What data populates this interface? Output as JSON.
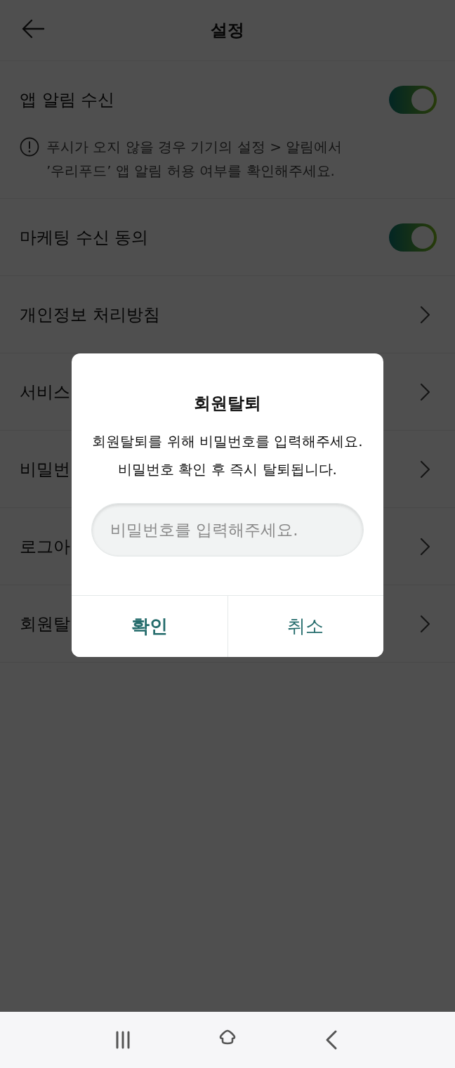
{
  "header": {
    "title": "설정"
  },
  "settings": [
    {
      "kind": "toggle",
      "label": "앱 알림 수신",
      "on": true,
      "note_lines": [
        "푸시가 오지 않을 경우 기기의 설정 > 알림에서",
        "’우리푸드’ 앱 알림 허용 여부를 확인해주세요."
      ]
    },
    {
      "kind": "toggle",
      "label": "마케팅 수신 동의",
      "on": true
    },
    {
      "kind": "link",
      "label": "개인정보 처리방침"
    },
    {
      "kind": "link",
      "label": "서비스"
    },
    {
      "kind": "link",
      "label": "비밀번"
    },
    {
      "kind": "link",
      "label": "로그아"
    },
    {
      "kind": "link",
      "label": "회원탈"
    }
  ],
  "dialog": {
    "title": "회원탈퇴",
    "message_lines": [
      "회원탈퇴를 위해 비밀번호를 입력해주세요.",
      "비밀번호 확인 후 즉시 탈퇴됩니다."
    ],
    "password_field": {
      "placeholder": "비밀번호를 입력해주세요."
    },
    "buttons": [
      {
        "label": "확인",
        "kind": "primary"
      },
      {
        "label": "취소",
        "kind": "secondary"
      }
    ]
  }
}
